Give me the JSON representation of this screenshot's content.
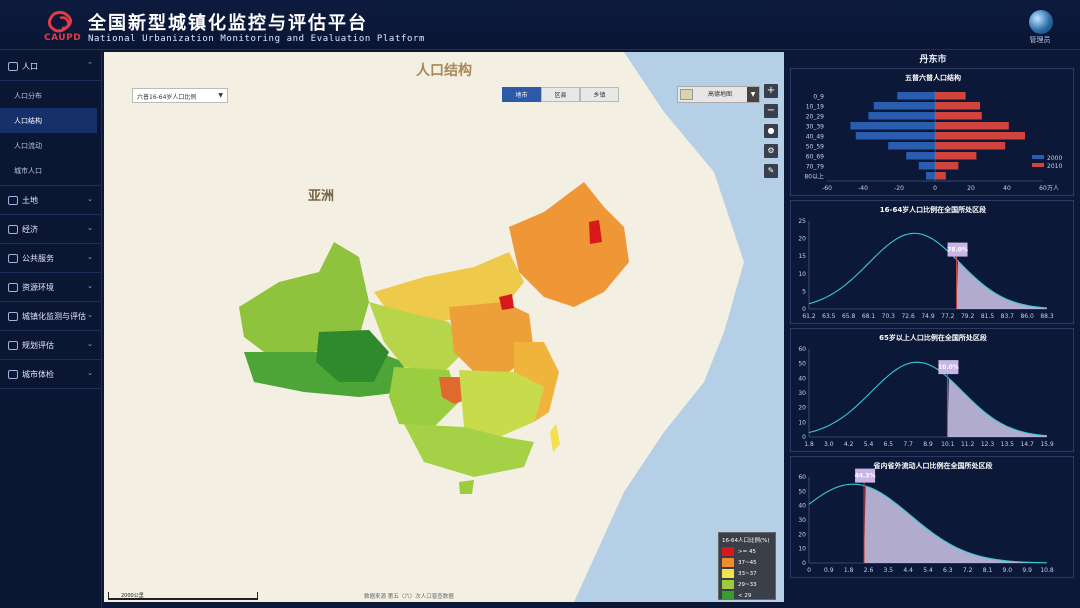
{
  "header": {
    "logo_text": "CAUPD",
    "title": "全国新型城镇化监控与评估平台",
    "subtitle": "National Urbanization Monitoring and Evaluation Platform",
    "admin_label": "管理员"
  },
  "sidebar": {
    "items": [
      {
        "label": "人口",
        "expanded": true,
        "subitems": [
          "人口分布",
          "人口结构",
          "人口流动",
          "城市人口"
        ],
        "active_sub": 1
      },
      {
        "label": "土地"
      },
      {
        "label": "经济"
      },
      {
        "label": "公共服务"
      },
      {
        "label": "资源环境"
      },
      {
        "label": "城镇化监测与评估"
      },
      {
        "label": "规划评估"
      },
      {
        "label": "城市体检"
      }
    ]
  },
  "map": {
    "title": "人口结构",
    "indicator_select": "六普16-64岁人口比例",
    "tabs": [
      "地市",
      "区县",
      "乡镇"
    ],
    "active_tab": 0,
    "basemap_label": "高德地图",
    "continent_label": "亚洲",
    "scale_label": "2000公里",
    "credit": "数据来源 第五（六）次人口普查数据",
    "legend": {
      "title": "16-64人口比例(%)",
      "items": [
        {
          "label": ">= 45",
          "color": "#d7191c"
        },
        {
          "label": "37~45",
          "color": "#f08c2d"
        },
        {
          "label": "33~37",
          "color": "#f2e14a"
        },
        {
          "label": "29~33",
          "color": "#9ccc3c"
        },
        {
          "label": "< 29",
          "color": "#3a9a2f"
        }
      ]
    }
  },
  "panel": {
    "city": "丹东市",
    "pyramid": {
      "title": "五普六普人口结构",
      "unit": "万人",
      "age_groups": [
        "0_9",
        "10_19",
        "20_29",
        "30_39",
        "40_49",
        "50_59",
        "60_69",
        "70_79",
        "80以上"
      ],
      "series": [
        {
          "name": "2000",
          "color": "#2a5db0",
          "values": [
            -21,
            -34,
            -37,
            -47,
            -44,
            -26,
            -16,
            -9,
            -5
          ]
        },
        {
          "name": "2010",
          "color": "#d0443d",
          "values": [
            17,
            25,
            26,
            41,
            50,
            39,
            23,
            13,
            6
          ]
        }
      ],
      "x_ticks": [
        "-60",
        "-40",
        "-20",
        "0",
        "20",
        "40",
        "60"
      ],
      "xlim": [
        -60,
        60
      ]
    },
    "dists": [
      {
        "title": "16-64岁人口比例在全国所处区段",
        "marker": "78.0%",
        "marker_value": 78.0,
        "ylim": [
          0,
          25
        ],
        "y_ticks": [
          "0",
          "5",
          "10",
          "15",
          "20",
          "25"
        ],
        "x_ticks": [
          "61.2",
          "63.5",
          "65.8",
          "68.1",
          "70.3",
          "72.6",
          "74.9",
          "77.2",
          "79.2",
          "81.5",
          "83.7",
          "86.0",
          "88.3"
        ],
        "xlim": [
          61.2,
          88.3
        ],
        "peak_x": 73.2,
        "peak_y": 21.5,
        "sigma": 5.2
      },
      {
        "title": "65岁以上人口比例在全国所处区段",
        "marker": "10.0%",
        "marker_value": 10.0,
        "ylim": [
          0,
          60
        ],
        "y_ticks": [
          "0",
          "10",
          "20",
          "30",
          "40",
          "50",
          "60"
        ],
        "x_ticks": [
          "1.8",
          "3.0",
          "4.2",
          "5.4",
          "6.5",
          "7.7",
          "8.9",
          "10.1",
          "11.2",
          "12.3",
          "13.5",
          "14.7",
          "15.9"
        ],
        "xlim": [
          1.8,
          15.9
        ],
        "peak_x": 8.2,
        "peak_y": 51,
        "sigma": 2.7
      },
      {
        "title": "省内省外流动人口比例在全国所处区段",
        "marker": "44.3%",
        "marker_value": 2.5,
        "ylim": [
          0,
          60
        ],
        "y_ticks": [
          "0",
          "10",
          "20",
          "30",
          "40",
          "50",
          "60"
        ],
        "x_ticks": [
          "0",
          "0.9",
          "1.8",
          "2.6",
          "3.5",
          "4.4",
          "5.4",
          "6.3",
          "7.2",
          "8.1",
          "9.0",
          "9.9",
          "10.8"
        ],
        "xlim": [
          0,
          10.8
        ],
        "peak_x": 2.0,
        "peak_y": 55,
        "sigma": 2.6
      }
    ]
  }
}
